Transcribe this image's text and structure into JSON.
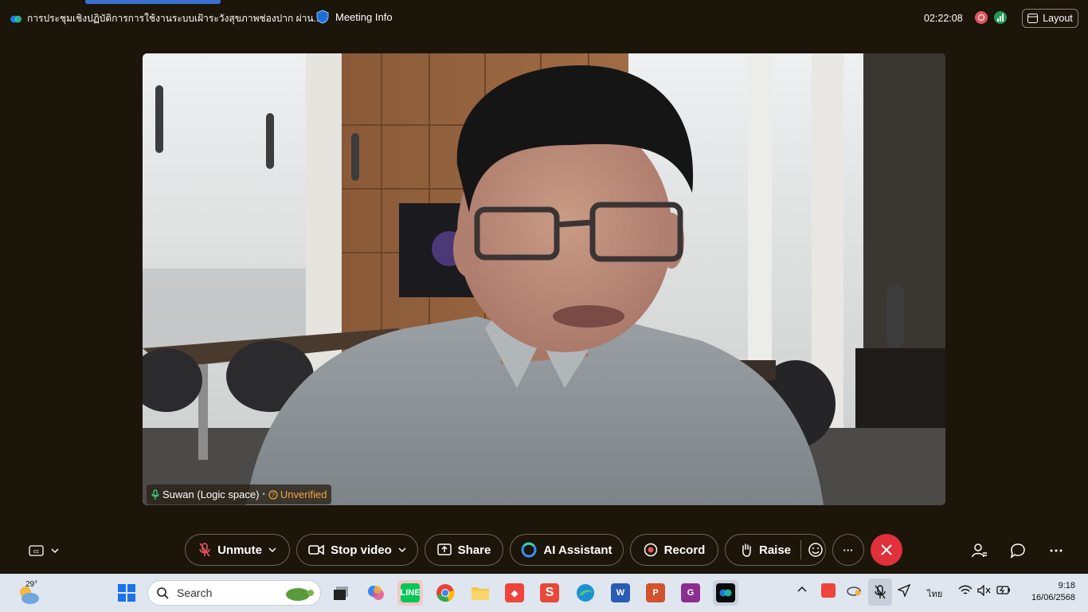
{
  "window": {
    "title": "การประชุมเชิงปฏิบัติการการใช้งานระบบเฝ้าระวังสุขภาพช่องปาก ผ่าน...",
    "meeting_info_label": "Meeting Info",
    "clock": "02:22:08",
    "layout_label": "Layout"
  },
  "video": {
    "participant_name": "Suwan (Logic space)",
    "separator": "•",
    "verification_status": "Unverified"
  },
  "controls": {
    "unmute_label": "Unmute",
    "stop_video_label": "Stop video",
    "share_label": "Share",
    "ai_assistant_label": "AI Assistant",
    "record_label": "Record",
    "raise_label": "Raise",
    "more_label": "···"
  },
  "taskbar": {
    "temperature": "29°",
    "search_placeholder": "Search",
    "language": "ไทย",
    "time": "9:18",
    "date": "16/06/2568"
  },
  "colors": {
    "background": "#1c1509",
    "end_call": "#e0303c",
    "unverified": "#f0a53a",
    "accent": "#3b6fd1"
  }
}
